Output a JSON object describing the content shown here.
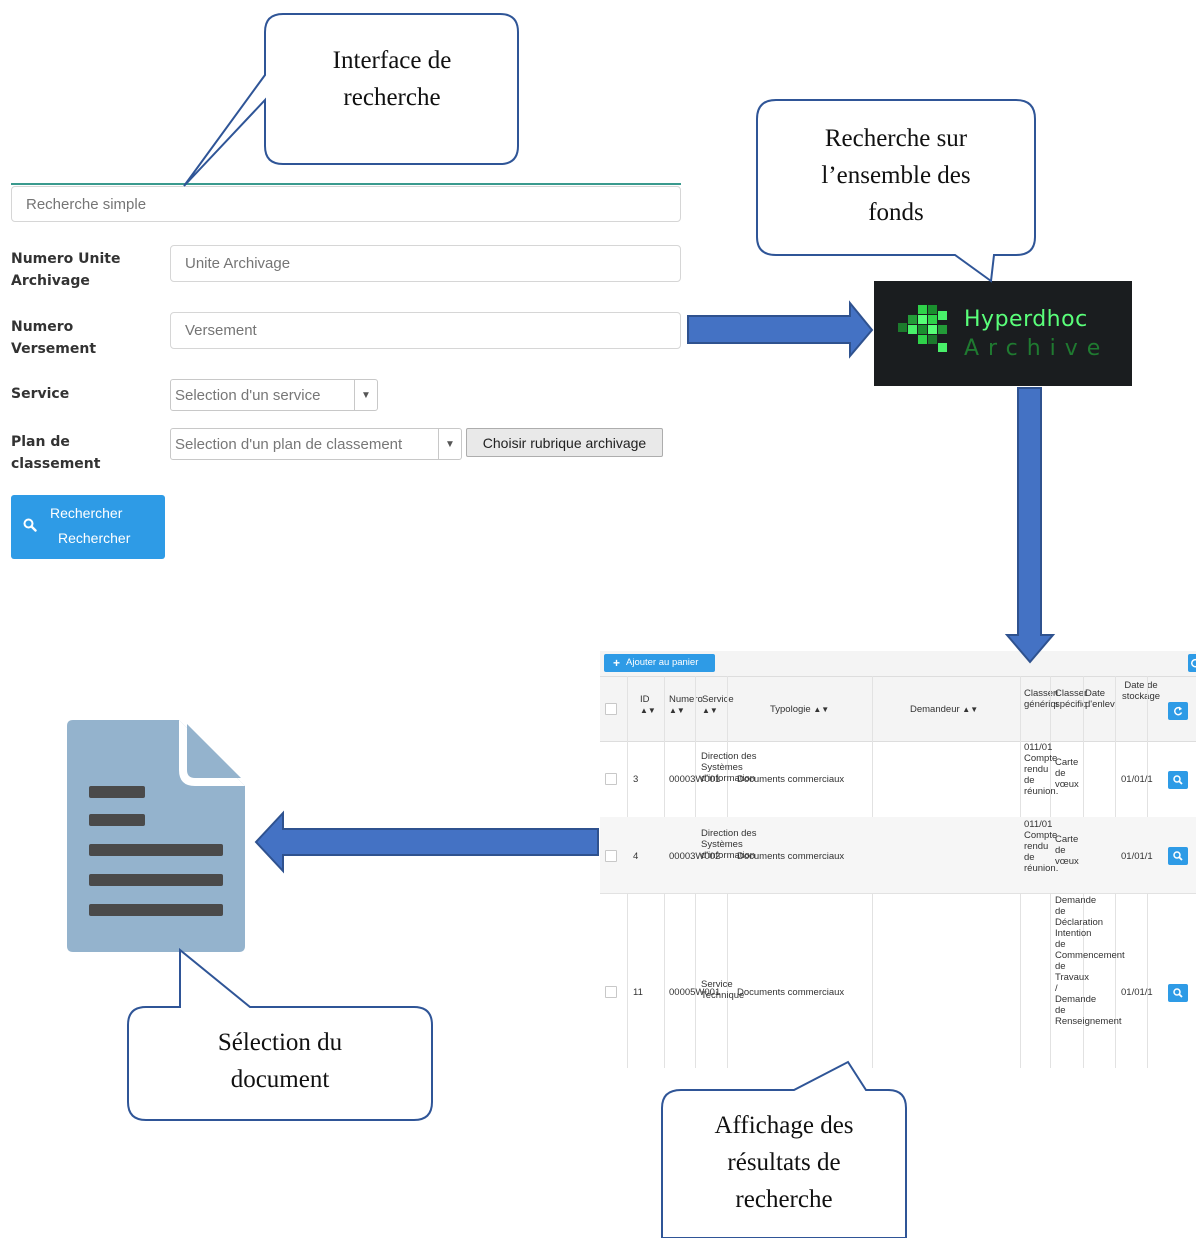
{
  "callouts": {
    "interface": "Interface de\nrecherche",
    "fonds": "Recherche sur\nl’ensemble des\nfonds",
    "selection": "Sélection du\ndocument",
    "affichage": "Affichage des\nrésultats de\nrecherche"
  },
  "search_form": {
    "simple_placeholder": "Recherche simple",
    "unite_label": "Numero Unite Archivage",
    "unite_placeholder": "Unite Archivage",
    "versement_label": "Numero Versement",
    "versement_placeholder": "Versement",
    "service_label": "Service",
    "service_select": "Selection d'un service",
    "plan_label": "Plan de classement",
    "plan_select": "Selection d'un plan de classement",
    "choisir_button": "Choisir rubrique archivage",
    "search_button_line1": "Rechercher",
    "search_button_line2": "Rechercher"
  },
  "logo": {
    "line1": "Hyperdhoc",
    "line2": "Archive"
  },
  "results": {
    "add_button": "Ajouter au panier",
    "headers": {
      "id": "ID",
      "numero": "Numero",
      "service": "Service",
      "typologie": "Typologie",
      "demandeur": "Demandeur",
      "classement_generique": "Classement générique",
      "classement_specifique": "Classement spécifique",
      "date_enlevement": "Date d'enlevement",
      "date_stockage": "Date de stockage"
    },
    "rows": [
      {
        "id": "3",
        "numero": "00003W001",
        "service": "Direction des Systèmes d'information",
        "typologie": "Documents commerciaux",
        "generique": "011/01 Compte rendu de réunion.",
        "specifique": "Carte de vœux",
        "date": "01/01/1"
      },
      {
        "id": "4",
        "numero": "00003W002",
        "service": "Direction des Systèmes d'information",
        "typologie": "Documents commerciaux",
        "generique": "011/01 Compte rendu de réunion.",
        "specifique": "Carte de vœux",
        "date": "01/01/1"
      },
      {
        "id": "11",
        "numero": "00005W001",
        "service": "Service Technique",
        "typologie": "Documents commerciaux",
        "generique": "",
        "specifique": "Demande de Déclaration Intention de Commencement de Travaux / Demande de Renseignement",
        "date": "01/01/1"
      }
    ]
  },
  "colors": {
    "arrow_fill": "#4472c4",
    "arrow_stroke": "#2f528f",
    "callout_stroke": "#2f5597",
    "accent_blue": "#2e9be6",
    "doc_icon": "#94b3cd",
    "doc_lines": "#4a4a4a"
  },
  "icons": [
    "search-icon",
    "plus-icon",
    "refresh-icon",
    "document-icon",
    "sort-icon",
    "logo-pixel-icon"
  ]
}
